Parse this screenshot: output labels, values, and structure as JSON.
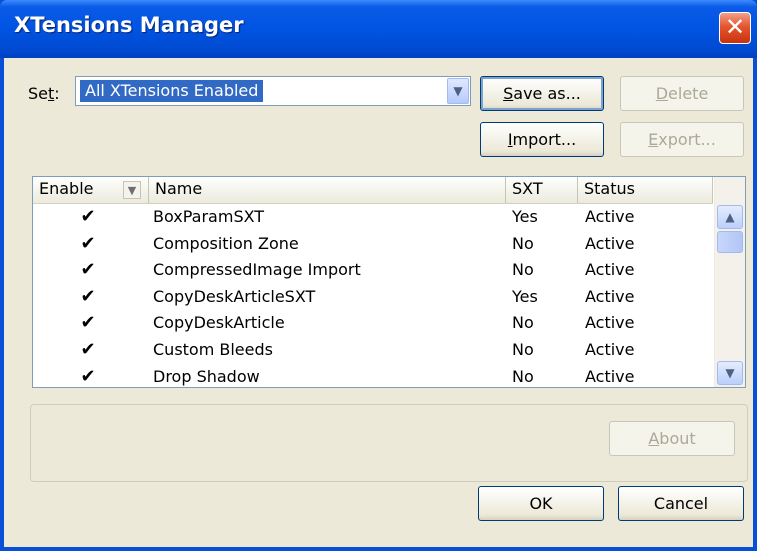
{
  "window": {
    "title": "XTensions Manager",
    "close_glyph": "✕"
  },
  "set": {
    "label_prefix": "Se",
    "label_accel": "t",
    "label_suffix": ":",
    "selected": "All XTensions Enabled"
  },
  "buttons": {
    "save_as": {
      "accel": "S",
      "rest": "ave as..."
    },
    "delete": {
      "accel": "D",
      "rest": "elete"
    },
    "import": {
      "accel": "I",
      "rest": "mport..."
    },
    "export": {
      "accel": "E",
      "rest": "xport..."
    },
    "about": {
      "accel": "A",
      "rest": "bout"
    },
    "ok": "OK",
    "cancel": "Cancel"
  },
  "table": {
    "columns": [
      "Enable",
      "Name",
      "SXT",
      "Status"
    ],
    "rows": [
      {
        "enabled": "✔",
        "name": "BoxParamSXT",
        "sxt": "Yes",
        "status": "Active"
      },
      {
        "enabled": "✔",
        "name": "Composition Zone",
        "sxt": "No",
        "status": "Active"
      },
      {
        "enabled": "✔",
        "name": "CompressedImage Import",
        "sxt": "No",
        "status": "Active"
      },
      {
        "enabled": "✔",
        "name": "CopyDeskArticleSXT",
        "sxt": "Yes",
        "status": "Active"
      },
      {
        "enabled": "✔",
        "name": "CopyDeskArticle",
        "sxt": "No",
        "status": "Active"
      },
      {
        "enabled": "✔",
        "name": "Custom Bleeds",
        "sxt": "No",
        "status": "Active"
      },
      {
        "enabled": "✔",
        "name": "Drop Shadow",
        "sxt": "No",
        "status": "Active"
      }
    ]
  },
  "icons": {
    "dropdown": "chevron-down-icon",
    "scroll_up": "chevron-up-icon",
    "scroll_down": "chevron-down-icon",
    "check": "checkmark-icon",
    "sort": "sort-arrow-icon"
  },
  "colors": {
    "title_bar": "#0054e3",
    "selection": "#316ac5",
    "close_button": "#e4562f",
    "dialog_bg": "#ece9d8"
  }
}
